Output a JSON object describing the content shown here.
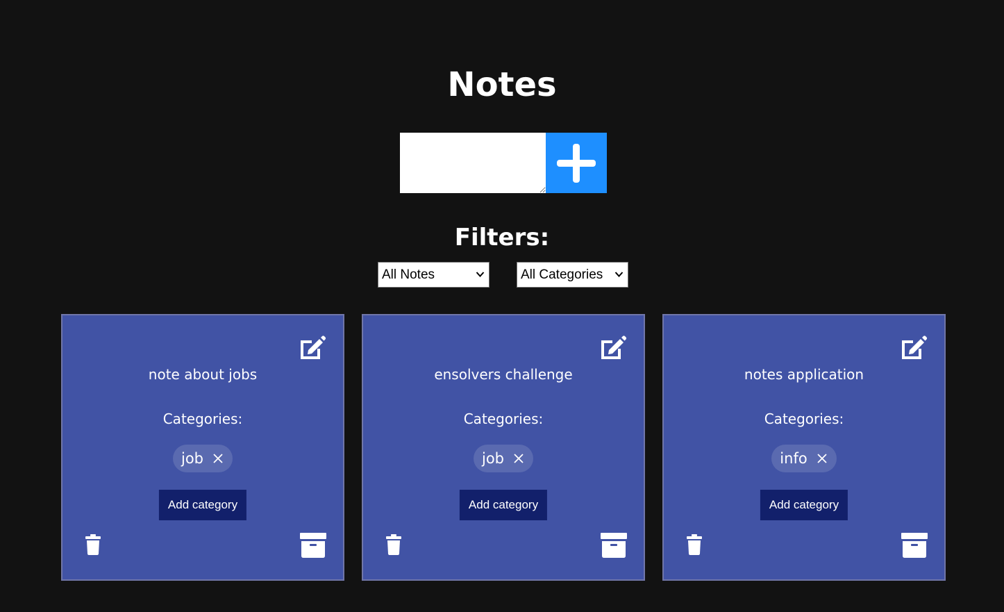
{
  "page": {
    "title": "Notes"
  },
  "new_note": {
    "text_value": "",
    "add_icon": "plus-icon"
  },
  "filters": {
    "title": "Filters:",
    "status_select": "All Notes",
    "category_select": "All Categories"
  },
  "notes": [
    {
      "text": "note about jobs",
      "categories_label": "Categories:",
      "categories": [
        "job"
      ],
      "add_category_label": "Add category"
    },
    {
      "text": "ensolvers challenge",
      "categories_label": "Categories:",
      "categories": [
        "job"
      ],
      "add_category_label": "Add category"
    },
    {
      "text": "notes application",
      "categories_label": "Categories:",
      "categories": [
        "info"
      ],
      "add_category_label": "Add category"
    }
  ],
  "colors": {
    "background": "#121212",
    "accent_blue": "#1e8fff",
    "card": "#4153a5",
    "chip": "#5a6ab0",
    "button_dark": "#12206b"
  },
  "icons": {
    "edit": "edit-icon",
    "delete": "trash-icon",
    "archive": "archive-icon",
    "remove_category": "close-icon",
    "select": "chevron-down-icon"
  }
}
